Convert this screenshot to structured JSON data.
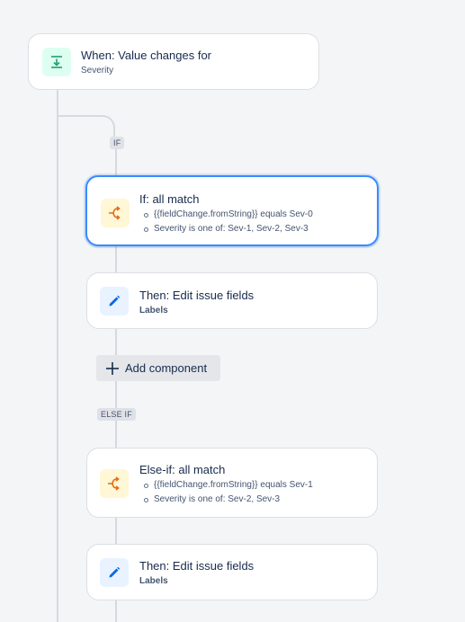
{
  "trigger": {
    "title": "When: Value changes for",
    "subtitle": "Severity",
    "icon": "field-change-icon",
    "accent": "#22a06b"
  },
  "branches": {
    "if_label": "IF",
    "else_if_label": "ELSE IF"
  },
  "if_block": {
    "title": "If: all match",
    "icon": "branch-icon",
    "conditions": [
      "{{fieldChange.fromString}} equals Sev-0",
      "Severity is one of: Sev-1, Sev-2, Sev-3"
    ]
  },
  "if_action": {
    "title": "Then: Edit issue fields",
    "subtitle": "Labels",
    "icon": "pencil-icon"
  },
  "add_component": {
    "label": "Add component",
    "icon": "plus-icon"
  },
  "else_if_block": {
    "title": "Else-if: all match",
    "icon": "branch-icon",
    "conditions": [
      "{{fieldChange.fromString}} equals Sev-1",
      "Severity is one of: Sev-2, Sev-3"
    ]
  },
  "else_if_action": {
    "title": "Then: Edit issue fields",
    "subtitle": "Labels",
    "icon": "pencil-icon"
  },
  "colors": {
    "selected_border": "#388bff",
    "condition_icon": "#e56910",
    "action_icon": "#0c66e4",
    "trigger_icon": "#22a06b"
  }
}
